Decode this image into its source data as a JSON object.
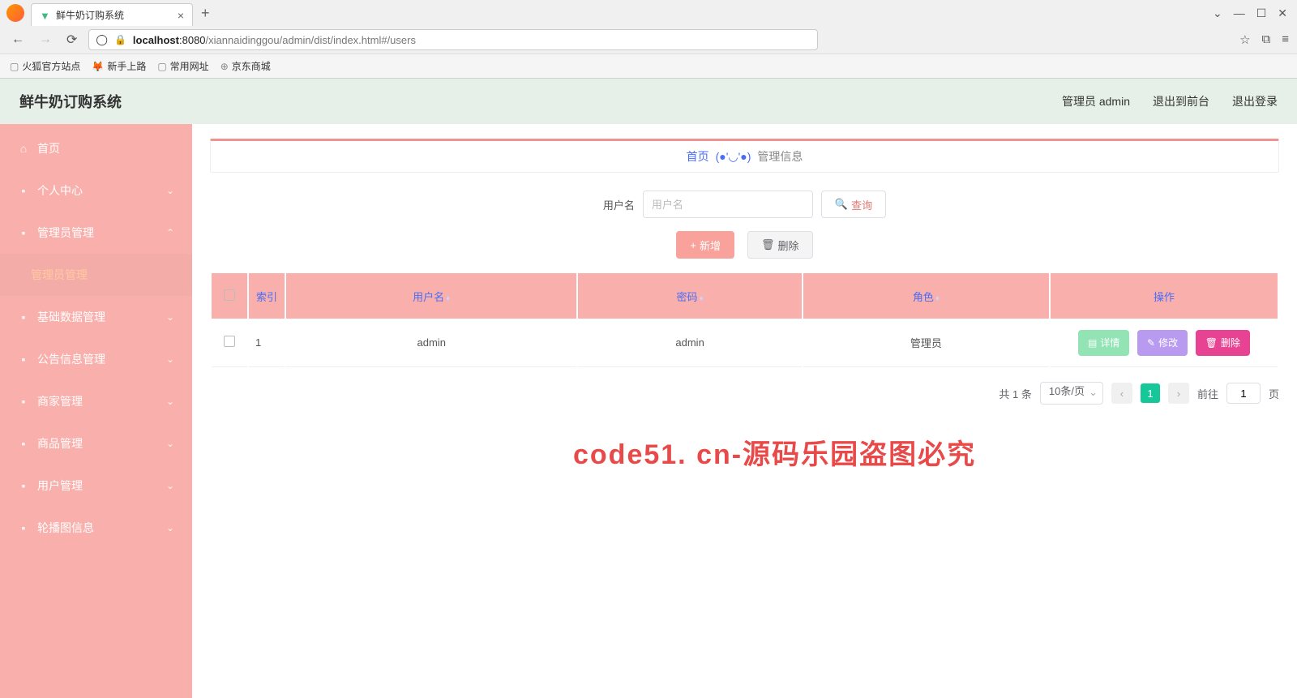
{
  "browser": {
    "tab_title": "鲜牛奶订购系统",
    "url_host": "localhost",
    "url_port": ":8080",
    "url_path": "/xiannaidinggou/admin/dist/index.html#/users",
    "bookmarks": [
      "火狐官方站点",
      "新手上路",
      "常用网址",
      "京东商城"
    ]
  },
  "header": {
    "title": "鲜牛奶订购系统",
    "user": "管理员 admin",
    "back": "退出到前台",
    "logout": "退出登录"
  },
  "sidebar": [
    {
      "icon": "⌂",
      "label": "首页",
      "expandable": false
    },
    {
      "icon": "👤",
      "label": "个人中心",
      "expandable": true,
      "open": false
    },
    {
      "icon": "🗄",
      "label": "管理员管理",
      "expandable": true,
      "open": true,
      "children": [
        {
          "label": "管理员管理"
        }
      ]
    },
    {
      "icon": "⚑",
      "label": "基础数据管理",
      "expandable": true,
      "open": false
    },
    {
      "icon": "📢",
      "label": "公告信息管理",
      "expandable": true,
      "open": false
    },
    {
      "icon": "🛍",
      "label": "商家管理",
      "expandable": true,
      "open": false
    },
    {
      "icon": "🏷",
      "label": "商品管理",
      "expandable": true,
      "open": false
    },
    {
      "icon": "📊",
      "label": "用户管理",
      "expandable": true,
      "open": false
    },
    {
      "icon": "🖥",
      "label": "轮播图信息",
      "expandable": true,
      "open": false
    }
  ],
  "breadcrumb": {
    "home": "首页",
    "face": "(●'◡'●)",
    "current": "管理信息"
  },
  "filter": {
    "label": "用户名",
    "placeholder": "用户名",
    "query": "查询"
  },
  "actions": {
    "add": "新增",
    "del": "删除"
  },
  "table": {
    "cols": [
      "索引",
      "用户名",
      "密码",
      "角色",
      "操作"
    ],
    "rows": [
      {
        "idx": "1",
        "username": "admin",
        "password": "admin",
        "role": "管理员"
      }
    ],
    "btns": {
      "detail": "详情",
      "edit": "修改",
      "del": "删除"
    }
  },
  "pager": {
    "total": "共 1 条",
    "size": "10条/页",
    "cur": "1",
    "go_label": "前往",
    "go_val": "1",
    "suffix": "页"
  },
  "watermark": "code51.cn",
  "bigwm": "code51. cn-源码乐园盗图必究"
}
